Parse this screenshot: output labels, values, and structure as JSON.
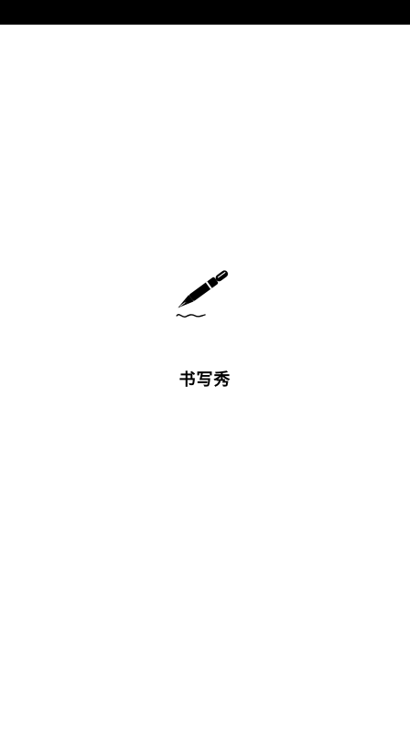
{
  "status_bar": {
    "color": "#000000"
  },
  "splash": {
    "logo_icon": "fountain-pen-signature-icon",
    "app_name": "书写秀"
  },
  "colors": {
    "background": "#ffffff",
    "ink": "#000000"
  }
}
